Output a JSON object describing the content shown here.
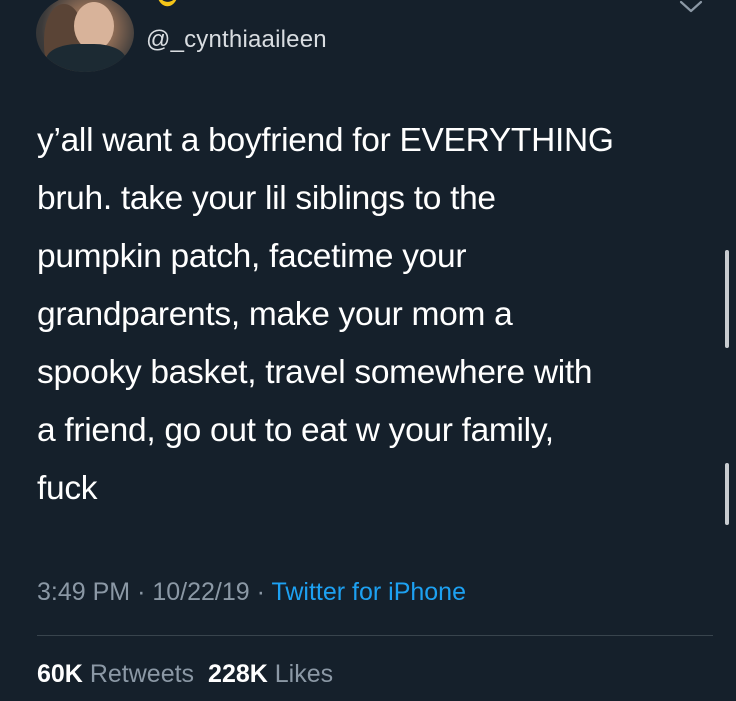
{
  "user": {
    "handle": "@_cynthiaaileen"
  },
  "tweet": {
    "text": "y’all want a boyfriend for EVERYTHING\nbruh. take your lil siblings to the\npumpkin patch, facetime your\ngrandparents, make your mom a\nspooky basket, travel somewhere with\na friend, go out to eat w your family,\nfuck",
    "time": "3:49 PM",
    "date": "10/22/19",
    "separator": "·",
    "source": "Twitter for iPhone"
  },
  "stats": {
    "retweets_count": "60K",
    "retweets_label": "Retweets",
    "likes_count": "228K",
    "likes_label": "Likes"
  },
  "icons": {
    "moon": "moon-icon",
    "chevron": "chevron-down-icon"
  },
  "colors": {
    "background": "#15202b",
    "text": "#ffffff",
    "secondary": "#8b98a5",
    "link": "#1da1f2"
  }
}
